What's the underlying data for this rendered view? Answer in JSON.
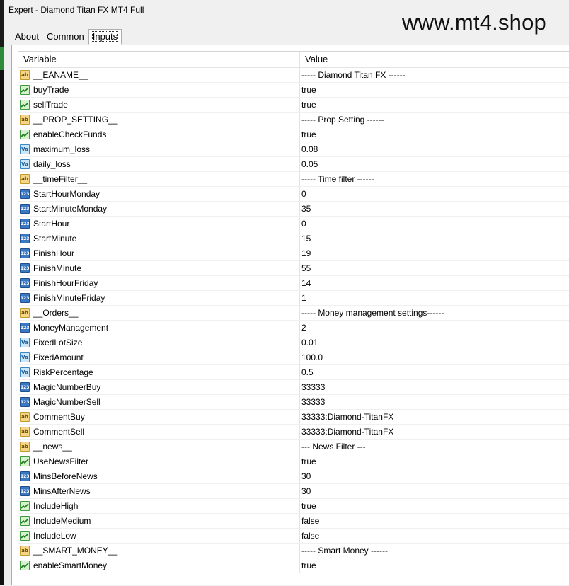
{
  "window": {
    "title": "Expert - Diamond Titan FX MT4 Full"
  },
  "watermark": "www.mt4.shop",
  "tabs": [
    "About",
    "Common",
    "Inputs"
  ],
  "table": {
    "headers": {
      "variable": "Variable",
      "value": "Value"
    },
    "rows": [
      {
        "type": "string",
        "icon": "string-icon",
        "name": "__EANAME__",
        "value": "----- Diamond Titan FX ------"
      },
      {
        "type": "bool",
        "icon": "bool-icon",
        "name": "buyTrade",
        "value": "true"
      },
      {
        "type": "bool",
        "icon": "bool-icon",
        "name": "sellTrade",
        "value": "true"
      },
      {
        "type": "string",
        "icon": "string-icon",
        "name": "__PROP_SETTING__",
        "value": "----- Prop Setting ------"
      },
      {
        "type": "bool",
        "icon": "bool-icon",
        "name": "enableCheckFunds",
        "value": "true"
      },
      {
        "type": "double",
        "icon": "double-icon",
        "name": "maximum_loss",
        "value": "0.08"
      },
      {
        "type": "double",
        "icon": "double-icon",
        "name": "daily_loss",
        "value": "0.05"
      },
      {
        "type": "string",
        "icon": "string-icon",
        "name": "__timeFilter__",
        "value": "----- Time filter ------"
      },
      {
        "type": "int",
        "icon": "integer-icon",
        "name": "StartHourMonday",
        "value": "0"
      },
      {
        "type": "int",
        "icon": "integer-icon",
        "name": "StartMinuteMonday",
        "value": "35"
      },
      {
        "type": "int",
        "icon": "integer-icon",
        "name": "StartHour",
        "value": "0"
      },
      {
        "type": "int",
        "icon": "integer-icon",
        "name": "StartMinute",
        "value": "15"
      },
      {
        "type": "int",
        "icon": "integer-icon",
        "name": "FinishHour",
        "value": "19"
      },
      {
        "type": "int",
        "icon": "integer-icon",
        "name": "FinishMinute",
        "value": "55"
      },
      {
        "type": "int",
        "icon": "integer-icon",
        "name": "FinishHourFriday",
        "value": "14"
      },
      {
        "type": "int",
        "icon": "integer-icon",
        "name": "FinishMinuteFriday",
        "value": "1"
      },
      {
        "type": "string",
        "icon": "string-icon",
        "name": "__Orders__",
        "value": "----- Money management settings------"
      },
      {
        "type": "int",
        "icon": "integer-icon",
        "name": "MoneyManagement",
        "value": "2"
      },
      {
        "type": "double",
        "icon": "double-icon",
        "name": "FixedLotSize",
        "value": "0.01"
      },
      {
        "type": "double",
        "icon": "double-icon",
        "name": "FixedAmount",
        "value": "100.0"
      },
      {
        "type": "double",
        "icon": "double-icon",
        "name": "RiskPercentage",
        "value": "0.5"
      },
      {
        "type": "int",
        "icon": "integer-icon",
        "name": "MagicNumberBuy",
        "value": "33333"
      },
      {
        "type": "int",
        "icon": "integer-icon",
        "name": "MagicNumberSell",
        "value": "33333"
      },
      {
        "type": "string",
        "icon": "string-icon",
        "name": "CommentBuy",
        "value": "33333:Diamond-TitanFX"
      },
      {
        "type": "string",
        "icon": "string-icon",
        "name": "CommentSell",
        "value": "33333:Diamond-TitanFX"
      },
      {
        "type": "string",
        "icon": "string-icon",
        "name": "__news__",
        "value": "--- News Filter ---"
      },
      {
        "type": "bool",
        "icon": "bool-icon",
        "name": "UseNewsFilter",
        "value": "true"
      },
      {
        "type": "int",
        "icon": "integer-icon",
        "name": "MinsBeforeNews",
        "value": "30"
      },
      {
        "type": "int",
        "icon": "integer-icon",
        "name": "MinsAfterNews",
        "value": "30"
      },
      {
        "type": "bool",
        "icon": "bool-icon",
        "name": "IncludeHigh",
        "value": "true"
      },
      {
        "type": "bool",
        "icon": "bool-icon",
        "name": "IncludeMedium",
        "value": "false"
      },
      {
        "type": "bool",
        "icon": "bool-icon",
        "name": "IncludeLow",
        "value": "false"
      },
      {
        "type": "string",
        "icon": "string-icon",
        "name": "__SMART_MONEY__",
        "value": "----- Smart Money ------"
      },
      {
        "type": "bool",
        "icon": "bool-icon",
        "name": "enableSmartMoney",
        "value": "true"
      }
    ]
  }
}
